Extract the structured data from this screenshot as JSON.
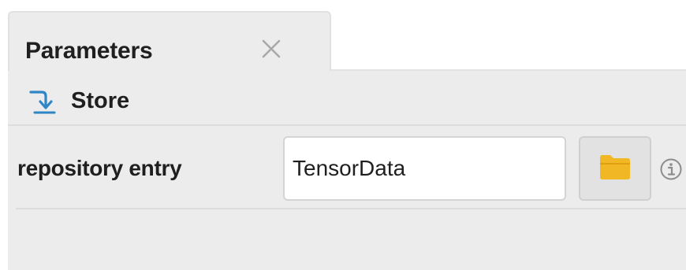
{
  "panel": {
    "tab": {
      "title": "Parameters"
    },
    "operator": {
      "name": "Store",
      "icon": "store-arrow-icon"
    },
    "parameters": [
      {
        "label": "repository entry",
        "value": "TensorData",
        "browse_icon": "folder-icon",
        "help_icon": "info-icon"
      }
    ]
  },
  "colors": {
    "tab_background": "#ececec",
    "panel_background": "#ececec",
    "store_icon": "#2f86c6",
    "folder_icon": "#f2b724"
  }
}
